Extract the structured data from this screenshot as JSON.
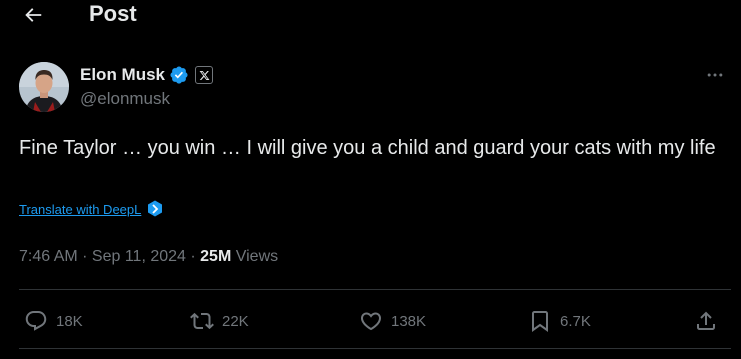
{
  "header": {
    "title": "Post"
  },
  "author": {
    "display_name": "Elon Musk",
    "handle": "@elonmusk",
    "verified_color": "#1d9bf0",
    "affiliate_badge": "X"
  },
  "tweet": {
    "text": "Fine Taylor … you win … I will give you a child and guard your cats with my life",
    "translate_label": "Translate with DeepL"
  },
  "meta": {
    "time": "7:46 AM",
    "separator": " · ",
    "date": "Sep 11, 2024",
    "views_count": "25M",
    "views_label": " Views"
  },
  "actions": {
    "replies": "18K",
    "reposts": "22K",
    "likes": "138K",
    "bookmarks": "6.7K"
  },
  "colors": {
    "background": "#000000",
    "text": "#e7e9ea",
    "secondary": "#71767b",
    "accent": "#1d9bf0",
    "divider": "#2f3336"
  },
  "icons": [
    "back-arrow-icon",
    "verified-badge-icon",
    "x-logo-icon",
    "more-icon",
    "deepl-icon",
    "reply-icon",
    "repost-icon",
    "like-icon",
    "bookmark-icon",
    "share-icon"
  ]
}
